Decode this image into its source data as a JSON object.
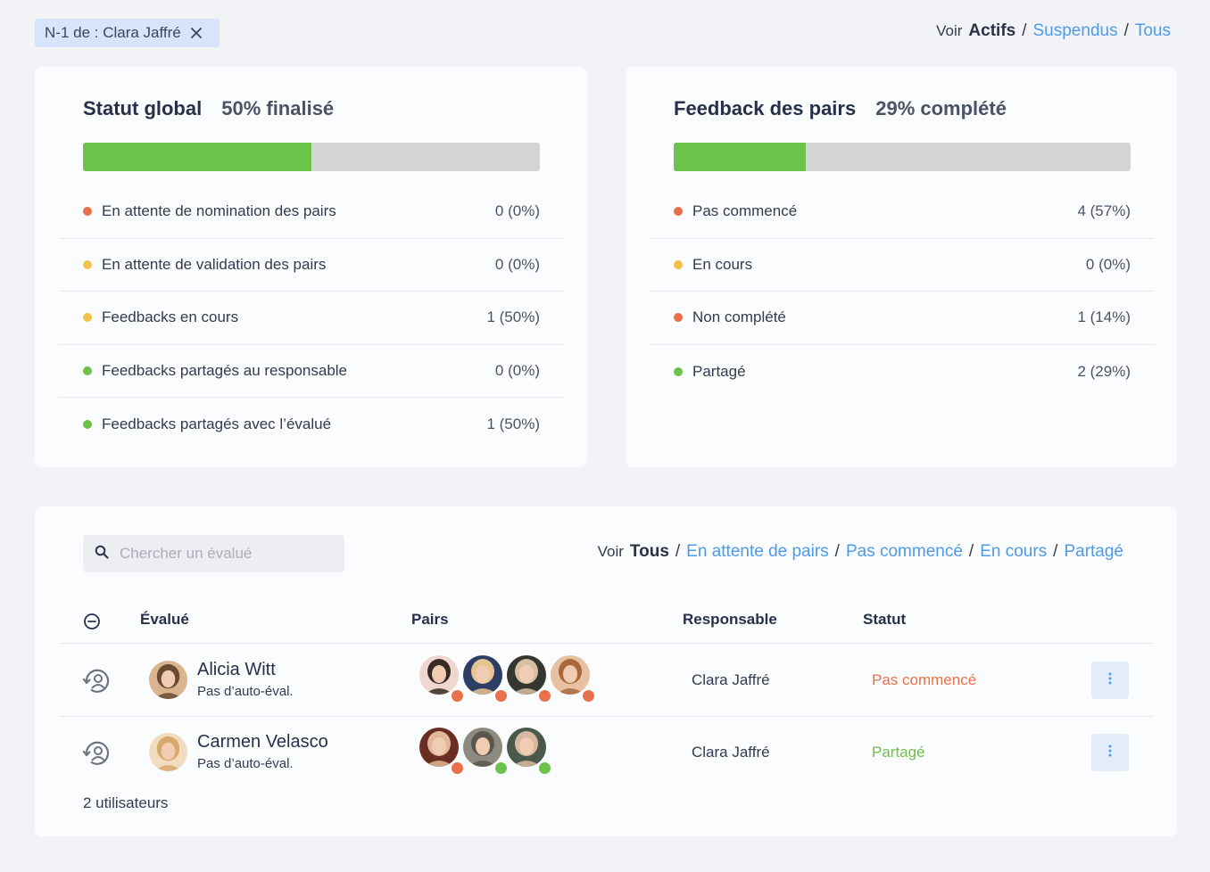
{
  "filter_chip": {
    "label": "N-1 de : Clara Jaffré"
  },
  "top_view": {
    "prefix": "Voir",
    "active": "Actifs",
    "links": [
      "Suspendus",
      "Tous"
    ]
  },
  "global_status": {
    "title": "Statut global",
    "progress_text": "50% finalisé",
    "progress_value": 0.5,
    "rows": [
      {
        "label": "En attente de nomination des pairs",
        "value": "0 (0%)",
        "color": "#e8704a"
      },
      {
        "label": "En attente de validation des pairs",
        "value": "0 (0%)",
        "color": "#f2c24b"
      },
      {
        "label": "Feedbacks en cours",
        "value": "1 (50%)",
        "color": "#f2c24b"
      },
      {
        "label": "Feedbacks partagés au responsable",
        "value": "0 (0%)",
        "color": "#6cc24a"
      },
      {
        "label": "Feedbacks partagés avec l’évalué",
        "value": "1 (50%)",
        "color": "#6cc24a"
      }
    ]
  },
  "peer_feedback": {
    "title": "Feedback des pairs",
    "progress_text": "29% complété",
    "progress_value": 0.29,
    "rows": [
      {
        "label": "Pas commencé",
        "value": "4 (57%)",
        "color": "#e8704a"
      },
      {
        "label": "En cours",
        "value": "0 (0%)",
        "color": "#f2c24b"
      },
      {
        "label": "Non complété",
        "value": "1 (14%)",
        "color": "#e8704a"
      },
      {
        "label": "Partagé",
        "value": "2 (29%)",
        "color": "#6cc24a"
      }
    ]
  },
  "table_section": {
    "search_placeholder": "Chercher un évalué",
    "view": {
      "prefix": "Voir",
      "active": "Tous",
      "links": [
        "En attente de pairs",
        "Pas commencé",
        "En cours",
        "Partagé"
      ]
    },
    "headers": {
      "evalue": "Évalué",
      "pairs": "Pairs",
      "responsable": "Responsable",
      "statut": "Statut"
    },
    "rows": [
      {
        "name": "Alicia Witt",
        "sub": "Pas d’auto-éval.",
        "avatar_colors": [
          "#d9b48f",
          "#6b4a33"
        ],
        "pairs": [
          {
            "colors": [
              "#efd6cf",
              "#3a2a25"
            ],
            "status_color": "#e8704a"
          },
          {
            "colors": [
              "#2c3e66",
              "#e6c48f"
            ],
            "status_color": "#e8704a"
          },
          {
            "colors": [
              "#33372f",
              "#d9c0a5"
            ],
            "status_color": "#e8704a"
          },
          {
            "colors": [
              "#e8c0a2",
              "#a86a3d"
            ],
            "status_color": "#e8704a"
          }
        ],
        "responsable": "Clara Jaffré",
        "status": "Pas commencé",
        "status_color": "#e8704a"
      },
      {
        "name": "Carmen Velasco",
        "sub": "Pas d’auto-éval.",
        "avatar_colors": [
          "#f1dcc0",
          "#d6a96b"
        ],
        "pairs": [
          {
            "colors": [
              "#6b2e22",
              "#e2b69a"
            ],
            "status_color": "#e8704a"
          },
          {
            "colors": [
              "#8d8a80",
              "#5b574e"
            ],
            "status_color": "#6cc24a"
          },
          {
            "colors": [
              "#4a5a4a",
              "#d7b8a0"
            ],
            "status_color": "#6cc24a"
          }
        ],
        "responsable": "Clara Jaffré",
        "status": "Partagé",
        "status_color": "#6cc24a"
      }
    ],
    "count_text": "2 utilisateurs"
  }
}
